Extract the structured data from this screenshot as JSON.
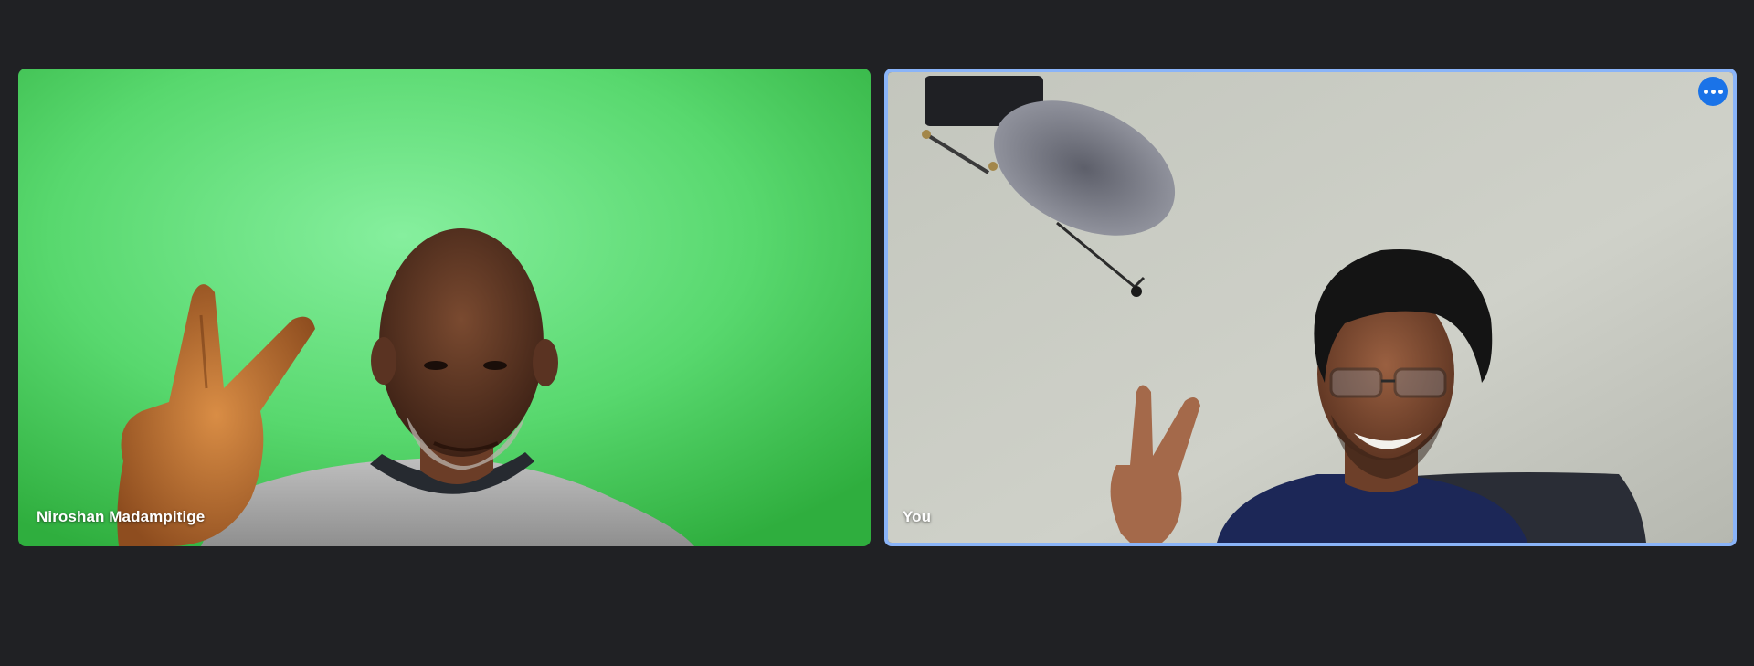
{
  "meeting": {
    "background_color": "#202124",
    "accent_color": "#1a73e8",
    "active_speaker_border_color": "#8ab4f8"
  },
  "participants": [
    {
      "name": "Niroshan Madampitige",
      "video_background": "green screen"
    },
    {
      "name": "You",
      "video_background": "light grey wall",
      "options_icon": "more-horizontal-icon"
    }
  ]
}
